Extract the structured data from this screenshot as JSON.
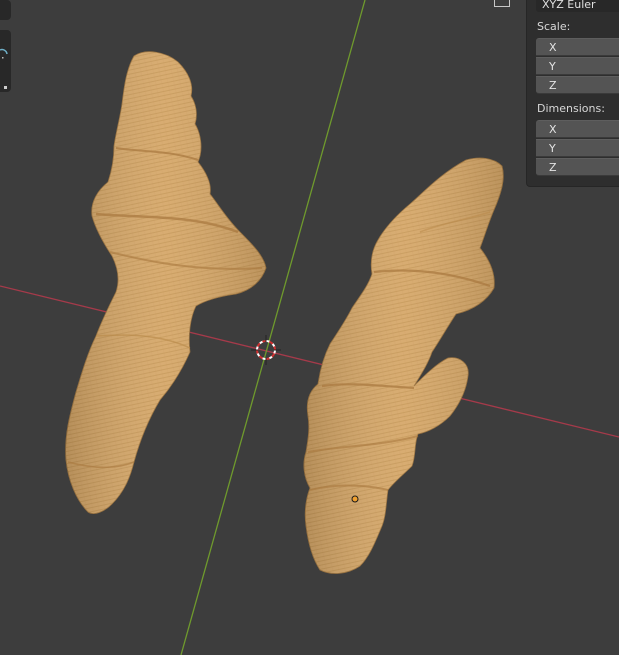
{
  "viewport": {
    "axis_colors": {
      "x_axis": "#a53a4a",
      "y_axis": "#6f9a2d"
    },
    "object_color": "#d6a86a",
    "origin_color": "#f0a030"
  },
  "npanel": {
    "rotation_mode": "XYZ Euler",
    "scale": {
      "label": "Scale:",
      "fields": [
        {
          "label": "X"
        },
        {
          "label": "Y"
        },
        {
          "label": "Z"
        }
      ]
    },
    "dimensions": {
      "label": "Dimensions:",
      "fields": [
        {
          "label": "X"
        },
        {
          "label": "Y"
        },
        {
          "label": "Z"
        }
      ]
    }
  }
}
